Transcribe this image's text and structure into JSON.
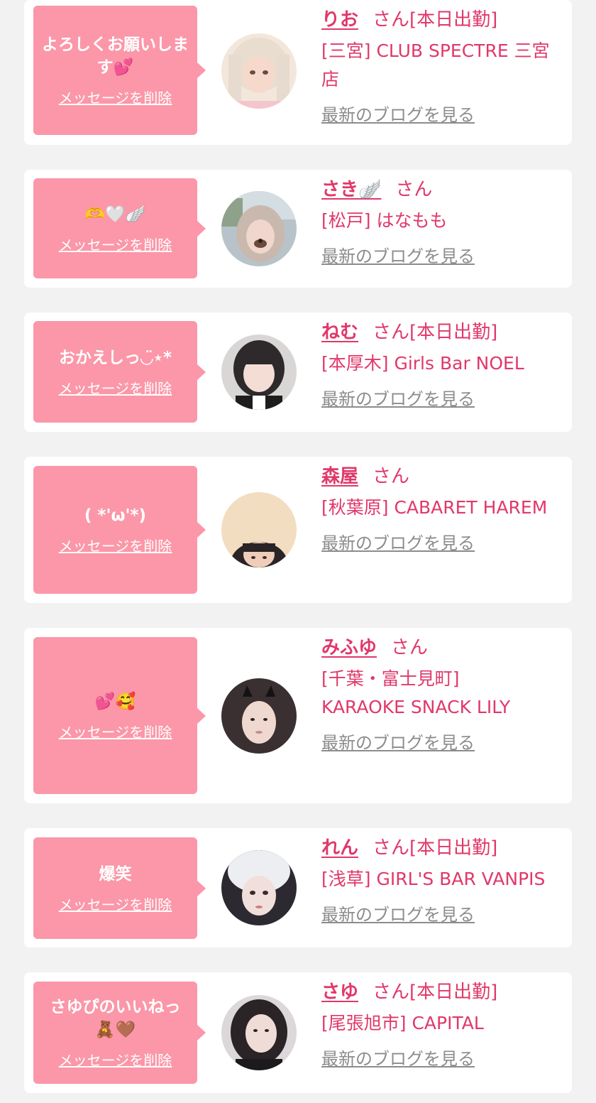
{
  "common": {
    "delete_label": "メッセージを削除",
    "blog_label": "最新のブログを見る"
  },
  "colors": {
    "background": "#f2f2f2",
    "bubble": "#fb97a8",
    "accent": "#e0386a",
    "muted_link": "#8c8c8c"
  },
  "entries": [
    {
      "message": "よろしくお願いします💕",
      "name": "りお",
      "suffix": "さん[本日出勤]",
      "shop": "[三宮] CLUB SPECTRE 三宮店",
      "avatar": "blonde-girl-photo"
    },
    {
      "message": "🫶🤍🪽",
      "name": "さき🪽",
      "suffix": "さん",
      "shop": "[松戸] はなもも",
      "avatar": "girl-with-dog-filter-photo"
    },
    {
      "message": "おかえしっ◡̈⋆*",
      "name": "ねむ",
      "suffix": "さん[本日出勤]",
      "shop": "[本厚木] Girls Bar NOEL",
      "avatar": "girl-in-maid-outfit-photo"
    },
    {
      "message": "( *'ω'*)",
      "name": "森屋",
      "suffix": "さん",
      "shop": "[秋葉原] CABARET HAREM",
      "avatar": "man-selfie-photo"
    },
    {
      "message": "💕🥰",
      "name": "みふゆ",
      "suffix": "さん",
      "shop": "[千葉・富士見町] KARAOKE SNACK LILY",
      "avatar": "girl-with-cat-ears-photo"
    },
    {
      "message": "爆笑",
      "name": "れん",
      "suffix": "さん[本日出勤]",
      "shop": "[浅草] GIRL'S BAR VANPIS",
      "avatar": "girl-with-white-hat-photo"
    },
    {
      "message": "さゆぴのいいねっ🧸🤎",
      "name": "さゆ",
      "suffix": "さん[本日出勤]",
      "shop": "[尾張旭市] CAPITAL",
      "avatar": "dark-haired-girl-photo"
    }
  ]
}
